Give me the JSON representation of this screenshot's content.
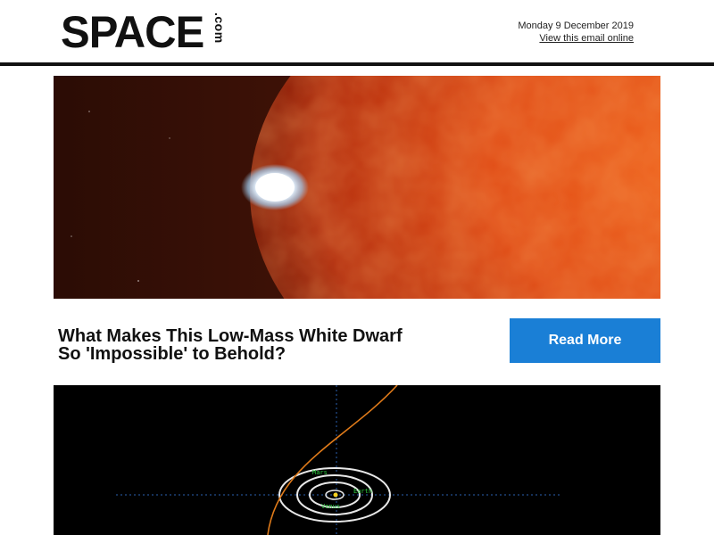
{
  "header": {
    "logo_text": "SPACE",
    "logo_suffix": ".com",
    "date": "Monday 9 December 2019",
    "view_online": "View this email online"
  },
  "article": {
    "headline_line1": "What Makes This Low-Mass White Dwarf",
    "headline_line2": "So 'Impossible' to Behold?",
    "read_more": "Read More"
  },
  "second_image": {
    "labels": [
      "Mars",
      "Earth",
      "Venus"
    ]
  },
  "colors": {
    "button": "#1a7fd6",
    "header_rule": "#111111",
    "trajectory": "#e07b1a"
  }
}
